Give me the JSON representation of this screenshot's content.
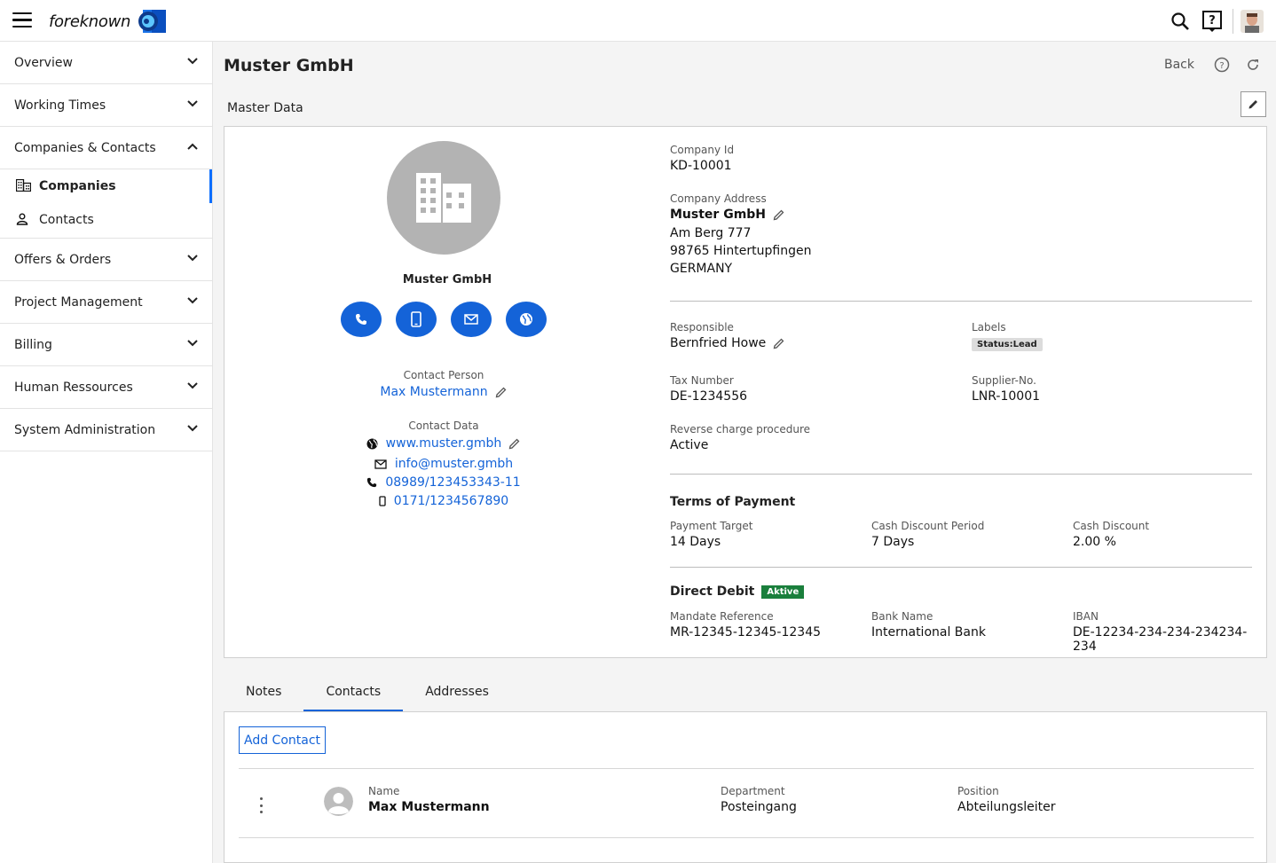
{
  "app": {
    "name": "foreknown"
  },
  "sidebar": {
    "items": [
      {
        "label": "Overview"
      },
      {
        "label": "Working Times"
      },
      {
        "label": "Companies & Contacts"
      },
      {
        "label": "Offers & Orders"
      },
      {
        "label": "Project Management"
      },
      {
        "label": "Billing"
      },
      {
        "label": "Human Ressources"
      },
      {
        "label": "System Administration"
      }
    ],
    "subitems": [
      {
        "label": "Companies",
        "active": true
      },
      {
        "label": "Contacts",
        "active": false
      }
    ]
  },
  "page": {
    "title": "Muster GmbH",
    "back_label": "Back",
    "section_label": "Master Data"
  },
  "company": {
    "name": "Muster GmbH",
    "contact_person_label": "Contact Person",
    "contact_person": "Max Mustermann",
    "contact_data_label": "Contact Data",
    "website": "www.muster.gmbh",
    "email": "info@muster.gmbh",
    "phone": "08989/123453343-11",
    "mobile": "0171/1234567890"
  },
  "details": {
    "company_id_label": "Company Id",
    "company_id": "KD-10001",
    "address_label": "Company Address",
    "address_name": "Muster GmbH",
    "address_street": "Am Berg 777",
    "address_city": "98765 Hintertupfingen",
    "address_country": "GERMANY",
    "responsible_label": "Responsible",
    "responsible": "Bernfried Howe",
    "labels_label": "Labels",
    "label_badge": "Status:Lead",
    "tax_label": "Tax Number",
    "tax": "DE-1234556",
    "supplier_label": "Supplier-No.",
    "supplier": "LNR-10001",
    "reverse_label": "Reverse charge procedure",
    "reverse": "Active",
    "terms_heading": "Terms of Payment",
    "payment_target_label": "Payment Target",
    "payment_target": "14 Days",
    "discount_period_label": "Cash Discount Period",
    "discount_period": "7 Days",
    "discount_label": "Cash Discount",
    "discount": "2.00 %",
    "debit_heading": "Direct Debit",
    "debit_badge": "Aktive",
    "mandate_label": "Mandate Reference",
    "mandate": "MR-12345-12345-12345",
    "bank_label": "Bank Name",
    "bank": "International Bank",
    "iban_label": "IBAN",
    "iban": "DE-12234-234-234-234234-234"
  },
  "tabs": [
    {
      "label": "Notes",
      "active": false
    },
    {
      "label": "Contacts",
      "active": true
    },
    {
      "label": "Addresses",
      "active": false
    }
  ],
  "contacts": {
    "add_label": "Add Contact",
    "columns": {
      "name": "Name",
      "department": "Department",
      "position": "Position"
    },
    "rows": [
      {
        "name": "Max Mustermann",
        "department": "Posteingang",
        "position": "Abteilungsleiter"
      }
    ]
  },
  "colors": {
    "accent": "#1463d8",
    "active_badge": "#1a7f3c",
    "avatar_gray": "#b3b3b3"
  }
}
